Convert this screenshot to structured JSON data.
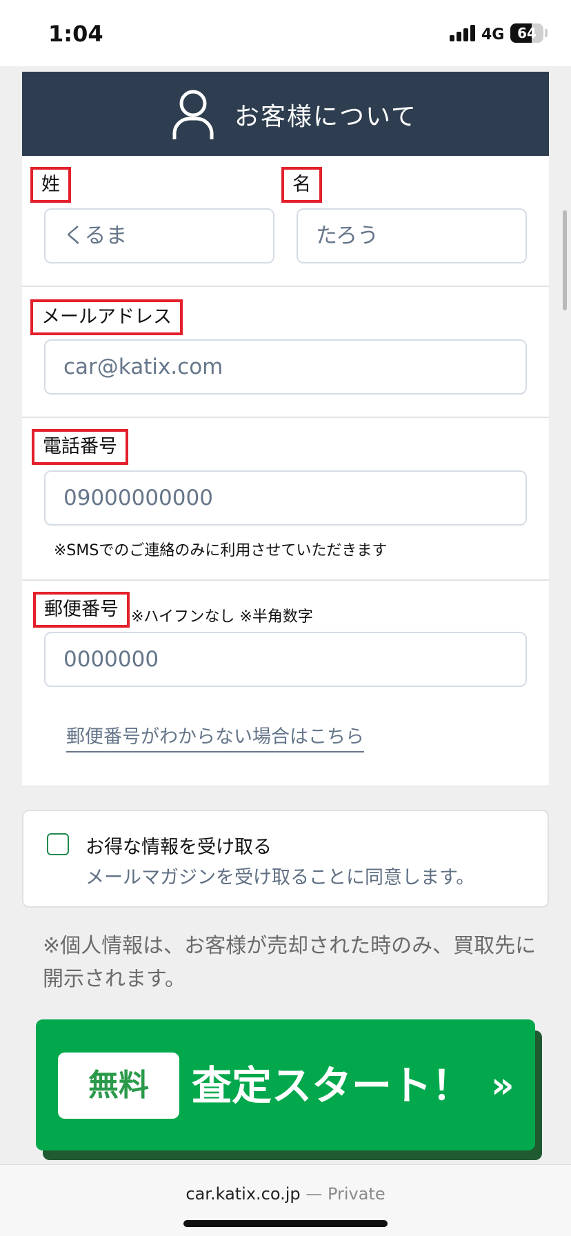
{
  "status_bar": {
    "time": "1:04",
    "network": "4G",
    "battery": "64",
    "battery_level_pct": 64
  },
  "section": {
    "title": "お客様について",
    "icon": "user-icon"
  },
  "name_fields": {
    "last_label": "姓",
    "last_placeholder": "くるま",
    "first_label": "名",
    "first_placeholder": "たろう"
  },
  "email_field": {
    "label": "メールアドレス",
    "placeholder": "car@katix.com"
  },
  "phone_field": {
    "label": "電話番号",
    "placeholder": "09000000000",
    "note": "※SMSでのご連絡のみに利用させていただきます"
  },
  "postal_field": {
    "label": "郵便番号",
    "note": "※ハイフンなし ※半角数字",
    "placeholder": "0000000",
    "help_link": "郵便番号がわからない場合はこちら"
  },
  "consent": {
    "title": "お得な情報を受け取る",
    "subtitle": "メールマガジンを受け取ることに同意します。",
    "checked": false
  },
  "privacy_note": "※個人情報は、お客様が売却された時のみ、買取先に開示されます。",
  "cta": {
    "badge": "無料",
    "label": "査定スタート！",
    "arrow": "»"
  },
  "browser": {
    "domain": "car.katix.co.jp",
    "separator": " — ",
    "mode": "Private"
  },
  "colors": {
    "header_bg": "#2e3e50",
    "label_border": "#e3202b",
    "cta_green": "#03a84c",
    "cta_shadow": "#1f5a30",
    "placeholder": "#66768a"
  }
}
